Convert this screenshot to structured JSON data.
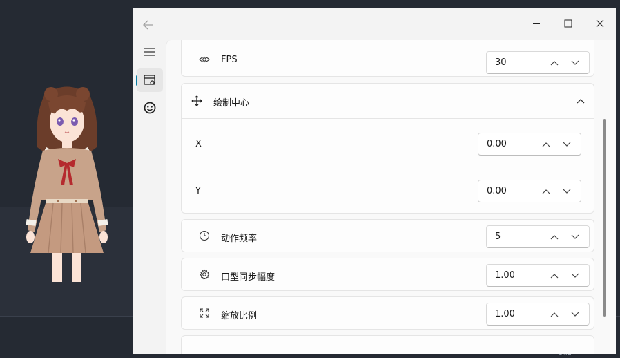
{
  "desktop": {
    "taskbar_hint": "cmd"
  },
  "window": {
    "title_controls": [
      "minimize-icon",
      "maximize-icon",
      "close-icon"
    ],
    "nav": [
      "menu-icon",
      "settings-window-icon",
      "face-icon"
    ]
  },
  "settings": {
    "fps": {
      "label": "FPS",
      "value": "30",
      "icon": "eye-icon"
    },
    "draw_center": {
      "label": "绘制中心",
      "icon": "move-icon",
      "x": {
        "label": "X",
        "value": "0.00"
      },
      "y": {
        "label": "Y",
        "value": "0.00"
      }
    },
    "action_freq": {
      "label": "动作频率",
      "value": "5",
      "icon": "clock-icon"
    },
    "lip_sync": {
      "label": "口型同步幅度",
      "value": "1.00",
      "icon": "gear-icon"
    },
    "scale": {
      "label": "缩放比例",
      "value": "1.00",
      "icon": "expand-icon"
    }
  },
  "colors": {
    "accent": "#0a7ea4"
  }
}
